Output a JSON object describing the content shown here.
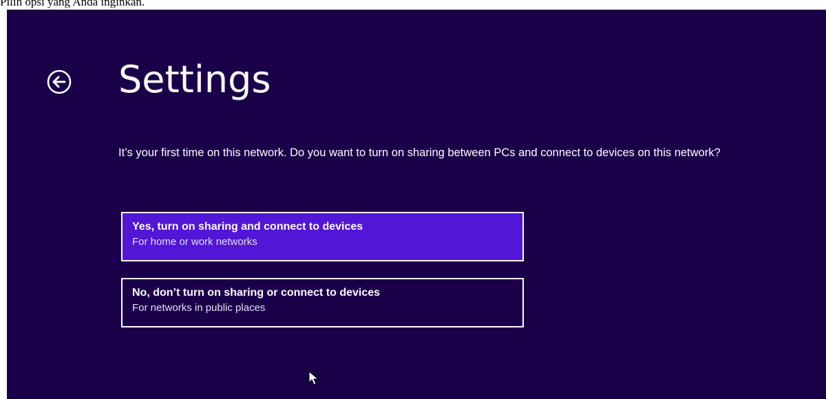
{
  "caption": "Pilih opsi yang Anda inginkan.",
  "colors": {
    "background": "#1a0049",
    "selected_option": "#5216d6",
    "text": "#ffffff",
    "caption_bg": "#ffffff"
  },
  "header": {
    "back_icon": "back-arrow-circle-icon",
    "title": "Settings"
  },
  "prompt": "It’s your first time on this network. Do you want to turn on sharing between PCs and connect to devices on this network?",
  "options": [
    {
      "title": "Yes, turn on sharing and connect to devices",
      "subtitle": "For home or work networks",
      "selected": true
    },
    {
      "title": "No, don’t turn on sharing or connect to devices",
      "subtitle": "For networks in public places",
      "selected": false
    }
  ],
  "cursor_icon": "mouse-pointer-icon"
}
